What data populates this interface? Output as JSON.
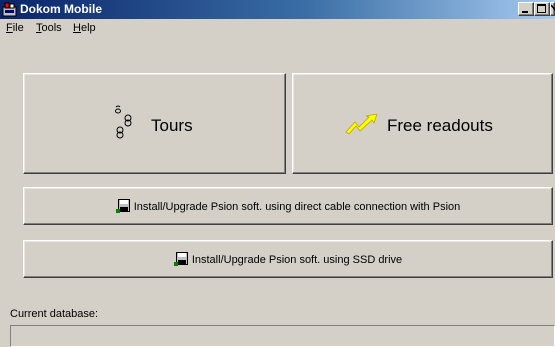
{
  "window": {
    "title": "Dokom Mobile"
  },
  "menu": {
    "file": "File",
    "tools": "Tools",
    "help": "Help"
  },
  "buttons": {
    "tours": "Tours",
    "free_readouts": "Free readouts",
    "install_cable": "Install/Upgrade Psion soft. using direct cable connection with Psion",
    "install_ssd": "Install/Upgrade Psion soft. using SSD drive"
  },
  "status": {
    "current_database_label": "Current database:",
    "current_database_value": ""
  },
  "icons": {
    "app": "app-icon",
    "tours": "tours-icon",
    "free_readouts": "lightning-icon",
    "install": "floppy-install-icon"
  },
  "colors": {
    "titlebar_start": "#0a246a",
    "titlebar_end": "#a6caf0",
    "face": "#d4d0c8",
    "lightning": "#ffff00"
  }
}
